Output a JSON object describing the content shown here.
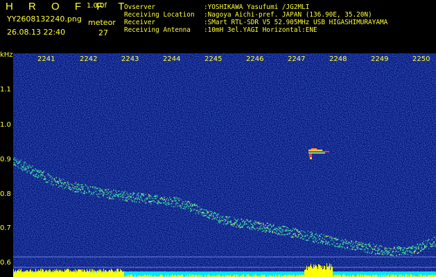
{
  "header": {
    "app_title": "H R O F F T",
    "version": "1.0.0f",
    "filename": "YY2608132240.png",
    "datetime": "26.08.13 22:40",
    "meteor_label": "meteor",
    "meteor_count": "27"
  },
  "info": [
    {
      "label": "Ovserver",
      "value": ":YOSHIKAWA Yasufumi /JG2MLI"
    },
    {
      "label": "Receiving Location",
      "value": ":Nagoya Aichi-pref. JAPAN (136.90E, 35.20N)"
    },
    {
      "label": "Receiver",
      "value": ":SMart RTL-SDR V5 52.905MHz USB HIGASHIMURAYAMA"
    },
    {
      "label": "Receiving Antenna",
      "value": ":10mH 3el.YAGI Horizontal:ENE"
    }
  ],
  "axis": {
    "unit": "kHz",
    "y_ticks": [
      "1.1",
      "1.0",
      "0.9",
      "0.8",
      "0.7",
      "0.6"
    ],
    "x_ticks": [
      "2241",
      "2242",
      "2243",
      "2244",
      "2245",
      "2246",
      "2247",
      "2248",
      "2249",
      "2250"
    ]
  },
  "colors": {
    "text": "#ffff3a",
    "background": "#000f74",
    "trace": "#39e6a0",
    "echo_hot": "#ff3040",
    "bar_yellow": "#ffff00",
    "bar_cyan": "#00e5ff"
  }
}
